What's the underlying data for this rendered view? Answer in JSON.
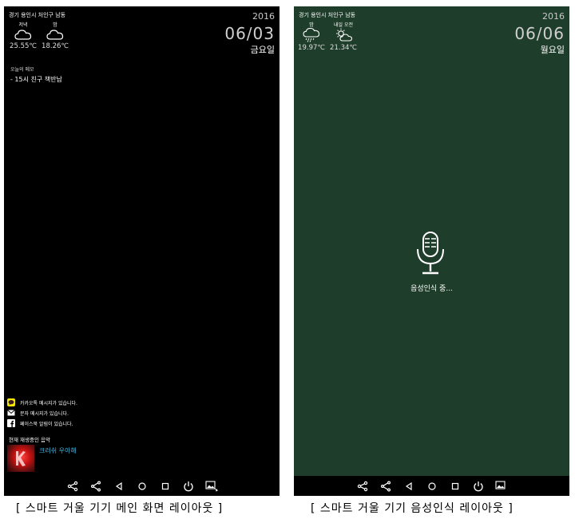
{
  "left": {
    "location": "경기 용인시 처인구 남동",
    "weather": [
      {
        "label": "저녁",
        "icon": "cloud-icon",
        "temp": "25.55℃"
      },
      {
        "label": "밤",
        "icon": "cloud-icon",
        "temp": "18.26℃"
      }
    ],
    "year": "2016",
    "date": "06/03",
    "weekday": "금요일",
    "memo": {
      "title": "오늘의 메모",
      "items": [
        "- 15시 친구 책반납"
      ]
    },
    "notifications": [
      {
        "icon": "kakaotalk-icon",
        "text": "카카오톡 메시지가 있습니다."
      },
      {
        "icon": "mail-icon",
        "text": "문자 메시지가 있습니다."
      },
      {
        "icon": "facebook-icon",
        "text": "페이스북 알림이 있습니다."
      }
    ],
    "music": {
      "title": "현재 재생중인 음악",
      "song": "크러쉬 우아해"
    },
    "caption": "[ 스마트 거울 기기 메인 화면 레이아웃 ]"
  },
  "right": {
    "location": "경기 용인시 처인구 남동",
    "weather": [
      {
        "label": "밤",
        "icon": "rain-cloud-icon",
        "temp": "19.97℃"
      },
      {
        "label": "내일 오전",
        "icon": "partly-sunny-icon",
        "temp": "21.34℃"
      }
    ],
    "year": "2016",
    "date": "06/06",
    "weekday": "월요일",
    "voice_status": "음성인식 중...",
    "caption": "[ 스마트 거울 기기 음성인식 레이아웃 ]"
  },
  "colors": {
    "left_bg": "#000000",
    "right_bg": "#1f3d2b",
    "song": "#3fb6e0"
  },
  "navbar_icons": [
    "share-icon",
    "share-outline-icon",
    "back-icon",
    "home-icon",
    "recents-icon",
    "power-icon",
    "gallery-icon"
  ]
}
